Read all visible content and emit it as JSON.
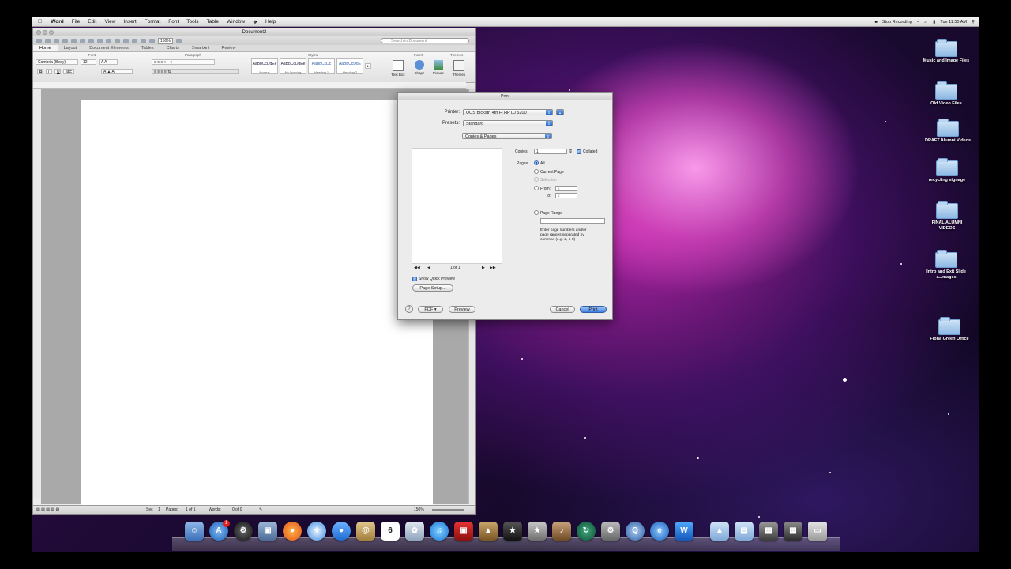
{
  "menubar": {
    "apple": "",
    "items": [
      "Word",
      "File",
      "Edit",
      "View",
      "Insert",
      "Format",
      "Font",
      "Tools",
      "Table",
      "Window",
      "Help"
    ],
    "recording": "Stop Recording",
    "clock": "Tue 11:50 AM"
  },
  "word": {
    "title": "Document2",
    "zoom": "150%",
    "search_placeholder": "Search in Document",
    "tabs": [
      "Home",
      "Layout",
      "Document Elements",
      "Tables",
      "Charts",
      "SmartArt",
      "Review"
    ],
    "groups": {
      "font": "Font",
      "paragraph": "Paragraph",
      "styles": "Styles",
      "insert": "Insert",
      "themes": "Themes"
    },
    "font_name": "Cambria (Body)",
    "font_size": "12",
    "styles": [
      {
        "preview": "AaBbCcDdEe",
        "name": "Normal"
      },
      {
        "preview": "AaBbCcDdEe",
        "name": "No Spacing"
      },
      {
        "preview": "AaBbCcDc",
        "name": "Heading 1"
      },
      {
        "preview": "AaBbCcDdE",
        "name": "Heading 2"
      }
    ],
    "insert_items": [
      "Text Box",
      "Shape",
      "Picture",
      "Themes"
    ],
    "status": {
      "sec_label": "Sec",
      "sec": "1",
      "pages_label": "Pages:",
      "pages": "1 of 1",
      "words_label": "Words:",
      "words": "0 of 0",
      "zoom": "150%"
    }
  },
  "print": {
    "title": "Print",
    "printer_label": "Printer:",
    "printer": "UOS Bickstn 4th Fl HP LJ 5200",
    "presets_label": "Presets:",
    "presets": "Standard",
    "section": "Copies & Pages",
    "copies_label": "Copies:",
    "copies": "1",
    "collated": "Collated",
    "pages_label": "Pages:",
    "opt_all": "All",
    "opt_current": "Current Page",
    "opt_selection": "Selection",
    "opt_from": "From:",
    "from": "1",
    "to_label": "to:",
    "to": "1",
    "opt_range": "Page Range",
    "range_help": "Enter page numbers and/or page ranges separated by commas (e.g. 2, 5-8)",
    "page_count": "1 of 1",
    "show_preview": "Show Quick Preview",
    "page_setup": "Page Setup...",
    "help": "?",
    "pdf": "PDF ▾",
    "preview": "Preview",
    "cancel": "Cancel",
    "print_btn": "Print"
  },
  "desktop_icons": [
    "Music and Image Files",
    "Old Video Files",
    "DRAFT Alumni Videos",
    "recycling signage",
    "FINAL ALUMNI VIDEOS",
    "Intro and Exit Slide a...mages",
    "Fiona Green Office"
  ],
  "dock": {
    "calendar_day": "6",
    "badge": "1"
  }
}
